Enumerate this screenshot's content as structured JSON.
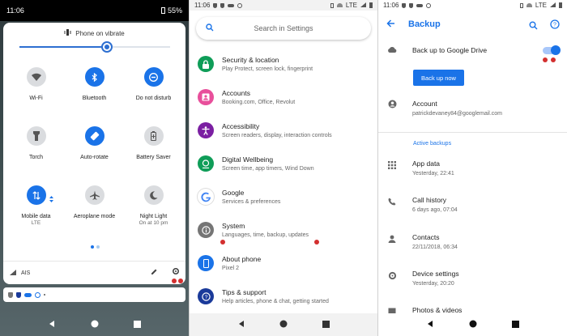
{
  "panel1": {
    "time": "11:06",
    "battery": "55%",
    "ringer": "Phone on vibrate",
    "brightness": 0.58,
    "tiles": [
      {
        "label": "Wi-Fi",
        "sub": "",
        "state": "off",
        "icon": "wifi-icon"
      },
      {
        "label": "Bluetooth",
        "sub": "",
        "state": "on",
        "icon": "bluetooth-icon"
      },
      {
        "label": "Do not disturb",
        "sub": "",
        "state": "on",
        "icon": "dnd-icon"
      },
      {
        "label": "Torch",
        "sub": "",
        "state": "off",
        "icon": "torch-icon"
      },
      {
        "label": "Auto-rotate",
        "sub": "",
        "state": "on",
        "icon": "auto-rotate-icon"
      },
      {
        "label": "Battery Saver",
        "sub": "",
        "state": "off",
        "icon": "battery-saver-icon"
      },
      {
        "label": "Mobile data",
        "sub": "LTE",
        "state": "on",
        "icon": "mobile-data-icon"
      },
      {
        "label": "Aeroplane mode",
        "sub": "",
        "state": "off",
        "icon": "aeroplane-icon"
      },
      {
        "label": "Night Light",
        "sub": "On at 10 pm",
        "state": "off",
        "icon": "night-light-icon"
      }
    ],
    "carrier": "AIS"
  },
  "panel2": {
    "time": "11:06",
    "network": "LTE",
    "search_placeholder": "Search in Settings",
    "items": [
      {
        "title": "Security & location",
        "sub": "Play Protect, screen lock, fingerprint",
        "color": "#0f9d58",
        "icon": "lock-icon"
      },
      {
        "title": "Accounts",
        "sub": "Booking.com, Office, Revolut",
        "color": "#e84f9b",
        "icon": "account-icon"
      },
      {
        "title": "Accessibility",
        "sub": "Screen readers, display, interaction controls",
        "color": "#7b1fa2",
        "icon": "accessibility-icon"
      },
      {
        "title": "Digital Wellbeing",
        "sub": "Screen time, app timers, Wind Down",
        "color": "#0f9d58",
        "icon": "wellbeing-icon"
      },
      {
        "title": "Google",
        "sub": "Services & preferences",
        "color": "#ffffff",
        "icon": "google-icon"
      },
      {
        "title": "System",
        "sub": "Languages, time, backup, updates",
        "color": "#757575",
        "icon": "info-icon"
      },
      {
        "title": "About phone",
        "sub": "Pixel 2",
        "color": "#1a73e8",
        "icon": "phone-icon"
      },
      {
        "title": "Tips & support",
        "sub": "Help articles, phone & chat, getting started",
        "color": "#1a3a9a",
        "icon": "help-icon"
      }
    ]
  },
  "panel3": {
    "time": "11:06",
    "network": "LTE",
    "title": "Backup",
    "backup_toggle_label": "Back up to Google Drive",
    "backup_now": "Back up now",
    "account_title": "Account",
    "account_email": "patrickdevaney84@googlemail.com",
    "section": "Active backups",
    "rows": [
      {
        "title": "App data",
        "sub": "Yesterday, 22:41",
        "icon": "apps-grid-icon"
      },
      {
        "title": "Call history",
        "sub": "6 days ago, 07:04",
        "icon": "phone-icon"
      },
      {
        "title": "Contacts",
        "sub": "22/11/2018, 06:34",
        "icon": "person-icon"
      },
      {
        "title": "Device settings",
        "sub": "Yesterday, 20:20",
        "icon": "gear-icon"
      },
      {
        "title": "Photos & videos",
        "sub": "",
        "icon": "photo-icon"
      }
    ]
  }
}
